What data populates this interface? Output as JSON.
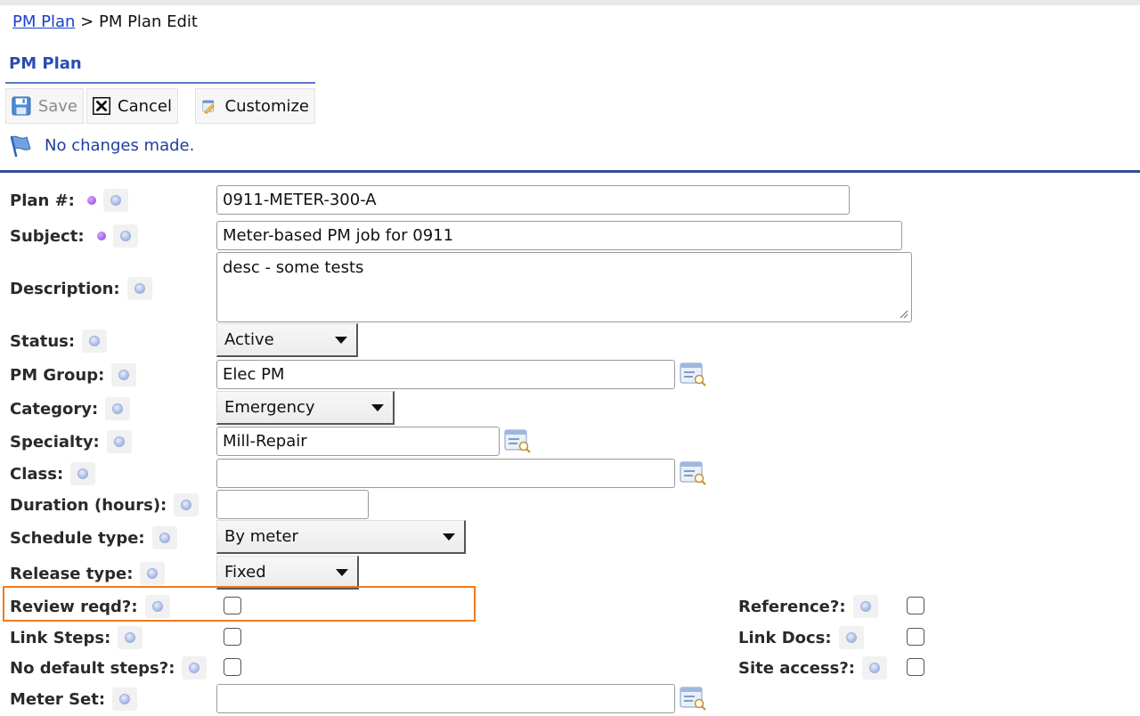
{
  "breadcrumb": {
    "link": "PM Plan",
    "separator": ">",
    "current": "PM Plan Edit"
  },
  "page_title": "PM Plan",
  "toolbar": {
    "save_label": "Save",
    "cancel_label": "Cancel",
    "customize_label": "Customize"
  },
  "status_message": "No changes made.",
  "colors": {
    "accent": "#2f4e9a",
    "link": "#1a3fd1",
    "highlight": "#f07a1a",
    "required_dot": "#8b3fd6"
  },
  "fields": {
    "plan_no": {
      "label": "Plan #:",
      "value": "0911-METER-300-A"
    },
    "subject": {
      "label": "Subject:",
      "value": "Meter-based PM job for 0911"
    },
    "description": {
      "label": "Description:",
      "value": "desc - some tests"
    },
    "status": {
      "label": "Status:",
      "value": "Active"
    },
    "pm_group": {
      "label": "PM Group:",
      "value": "Elec PM"
    },
    "category": {
      "label": "Category:",
      "value": "Emergency"
    },
    "specialty": {
      "label": "Specialty:",
      "value": "Mill-Repair"
    },
    "class": {
      "label": "Class:",
      "value": ""
    },
    "duration": {
      "label": "Duration (hours):",
      "value": ""
    },
    "schedule_type": {
      "label": "Schedule type:",
      "value": "By meter"
    },
    "release_type": {
      "label": "Release type:",
      "value": "Fixed"
    },
    "review_reqd": {
      "label": "Review reqd?:",
      "checked": false
    },
    "link_steps": {
      "label": "Link Steps:",
      "checked": false
    },
    "no_default_steps": {
      "label": "No default steps?:",
      "checked": false
    },
    "meter_set": {
      "label": "Meter Set:",
      "value": ""
    },
    "reference": {
      "label": "Reference?:",
      "checked": false
    },
    "link_docs": {
      "label": "Link Docs:",
      "checked": false
    },
    "site_access": {
      "label": "Site access?:",
      "checked": false
    }
  }
}
